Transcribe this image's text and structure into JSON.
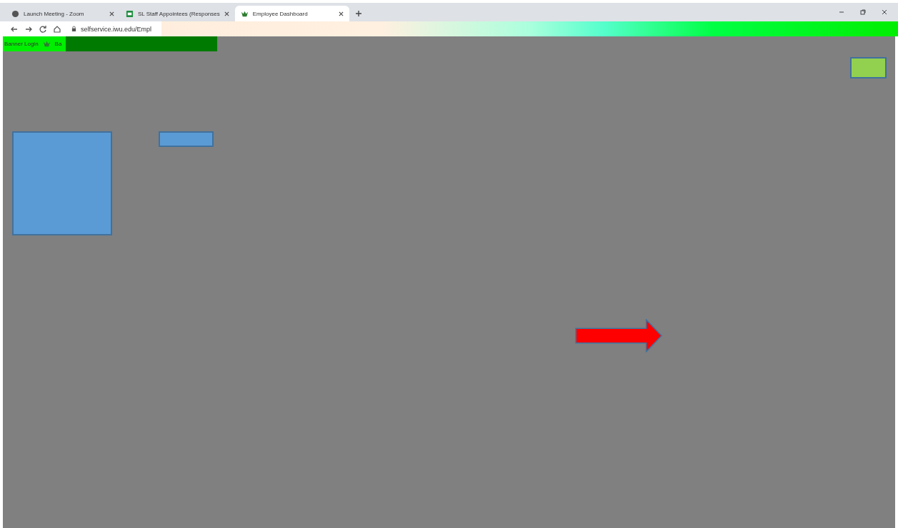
{
  "tabs": [
    {
      "title": "Launch Meeting - Zoom",
      "selected": false
    },
    {
      "title": "SL Staff Appointees (Responses",
      "selected": false
    },
    {
      "title": "Employee Dashboard",
      "selected": true
    }
  ],
  "address_bar": {
    "url": "selfservice.iwu.edu/Empl"
  },
  "bookmarks": [
    {
      "label": "Banner Login"
    },
    {
      "label": "Ba"
    }
  ]
}
